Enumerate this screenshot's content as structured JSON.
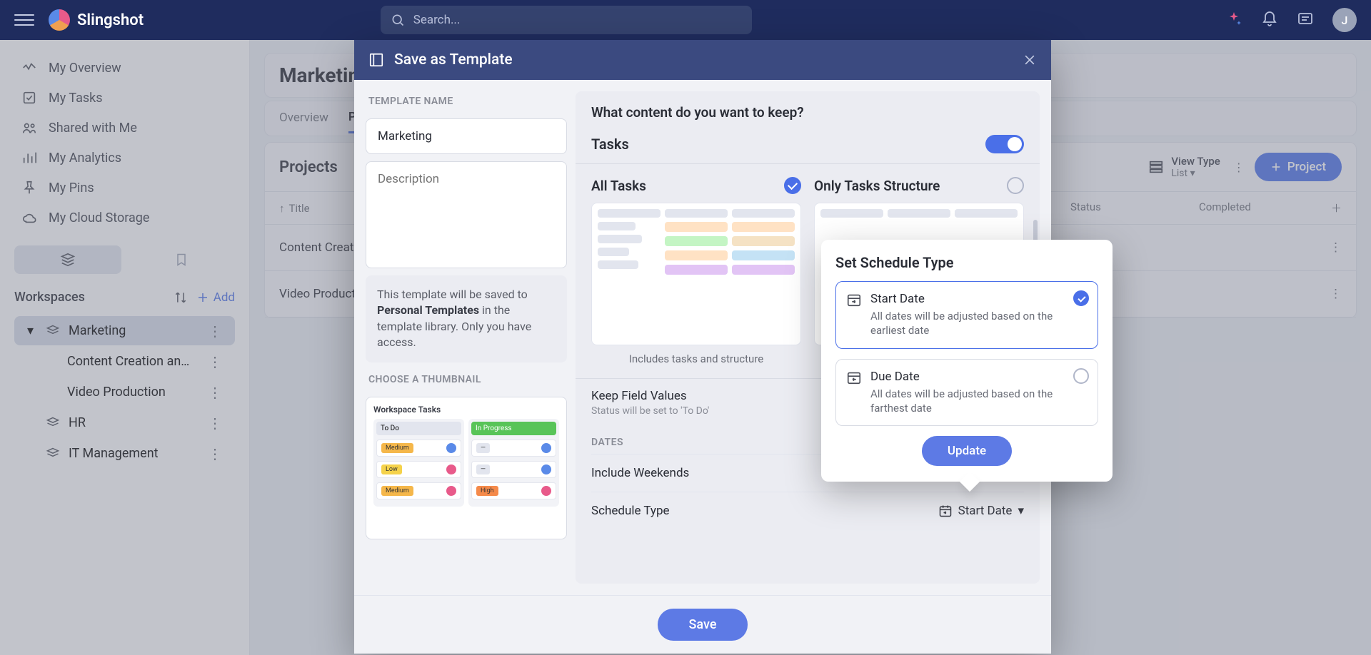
{
  "app": {
    "name": "Slingshot",
    "search_placeholder": "Search..."
  },
  "avatar_initial": "J",
  "sidebar": {
    "items": [
      {
        "label": "My Overview"
      },
      {
        "label": "My Tasks"
      },
      {
        "label": "Shared with Me"
      },
      {
        "label": "My Analytics"
      },
      {
        "label": "My Pins"
      },
      {
        "label": "My Cloud Storage"
      }
    ],
    "workspaces_label": "Workspaces",
    "add_label": "Add",
    "workspaces": [
      {
        "label": "Marketing",
        "active": true
      },
      {
        "label": "Content Creation an…",
        "child": true
      },
      {
        "label": "Video Production",
        "child": true
      },
      {
        "label": "HR"
      },
      {
        "label": "IT Management"
      }
    ]
  },
  "page": {
    "title": "Marketing",
    "tabs": [
      "Overview",
      "Projects"
    ],
    "active_tab": "Projects",
    "projects_label": "Projects",
    "view_type_label": "View Type",
    "view_type_value": "List",
    "project_button": "Project",
    "columns": {
      "title": "Title",
      "status": "Status",
      "completed": "Completed"
    },
    "rows": [
      "Content Creation",
      "Video Production"
    ]
  },
  "modal": {
    "title": "Save as Template",
    "template_name_label": "TEMPLATE NAME",
    "name_value": "Marketing",
    "description_placeholder": "Description",
    "hint_pre": "This template will be saved to ",
    "hint_strong": "Personal Templates",
    "hint_post": " in the template library. Only you have access.",
    "thumb_label": "CHOOSE A THUMBNAIL",
    "thumb_title": "Workspace Tasks",
    "thumb_cols": [
      "To Do",
      "In Progress"
    ],
    "content_question": "What content do you want to keep?",
    "tasks_label": "Tasks",
    "all_tasks_label": "All Tasks",
    "all_tasks_caption": "Includes tasks and structure",
    "only_structure_label": "Only Tasks Structure",
    "keep_field_values": "Keep Field Values",
    "keep_field_sub": "Status will be set to 'To Do'",
    "dates_label": "DATES",
    "include_weekends": "Include Weekends",
    "schedule_type_label": "Schedule Type",
    "schedule_type_value": "Start Date",
    "save_button": "Save"
  },
  "popover": {
    "title": "Set Schedule Type",
    "options": [
      {
        "title": "Start Date",
        "desc": "All dates will be adjusted based on the earliest date",
        "selected": true
      },
      {
        "title": "Due Date",
        "desc": "All dates will be adjusted based on the farthest date",
        "selected": false
      }
    ],
    "update_button": "Update"
  }
}
